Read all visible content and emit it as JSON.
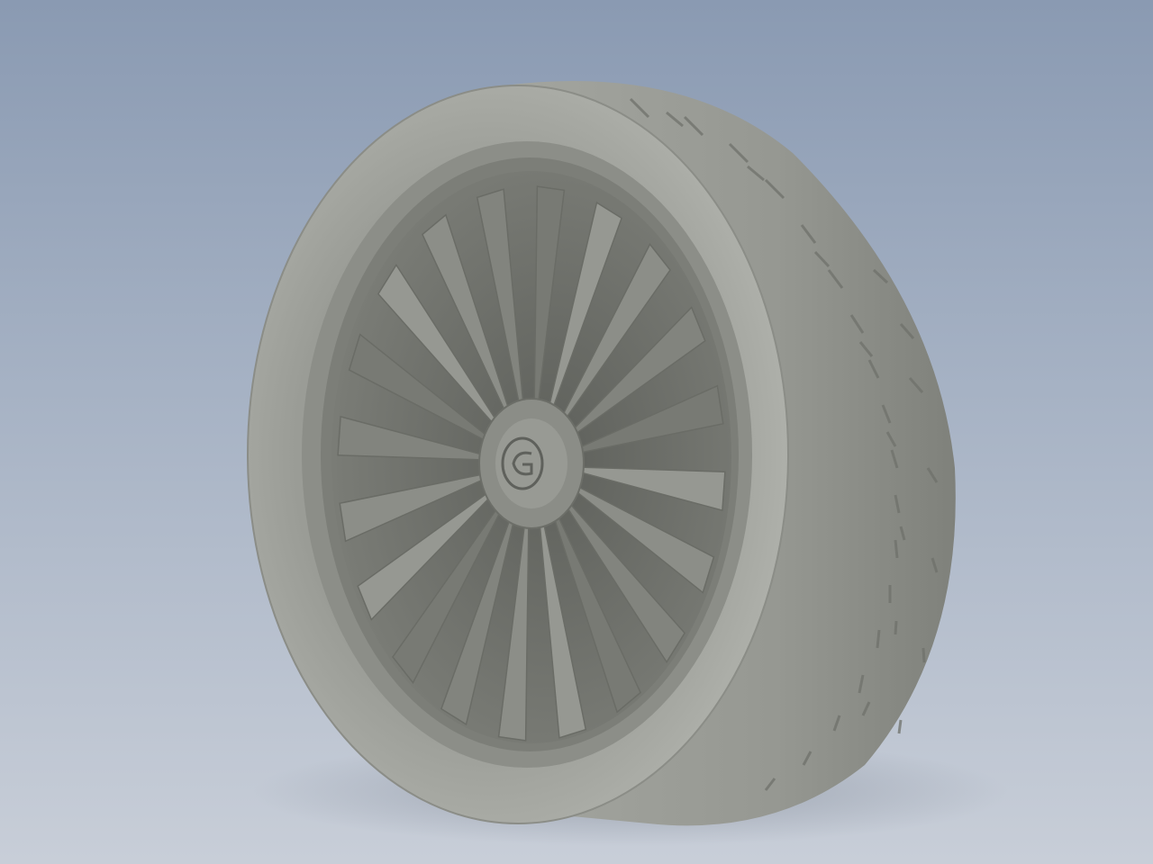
{
  "viewport": {
    "background_top": "#8a9ab2",
    "background_bottom": "#c8ced8"
  },
  "model": {
    "object": "wheel-with-tire",
    "material_color": "#8f918b",
    "spoke_count": 20,
    "center_cap_icon": "brand-logo-icon"
  }
}
